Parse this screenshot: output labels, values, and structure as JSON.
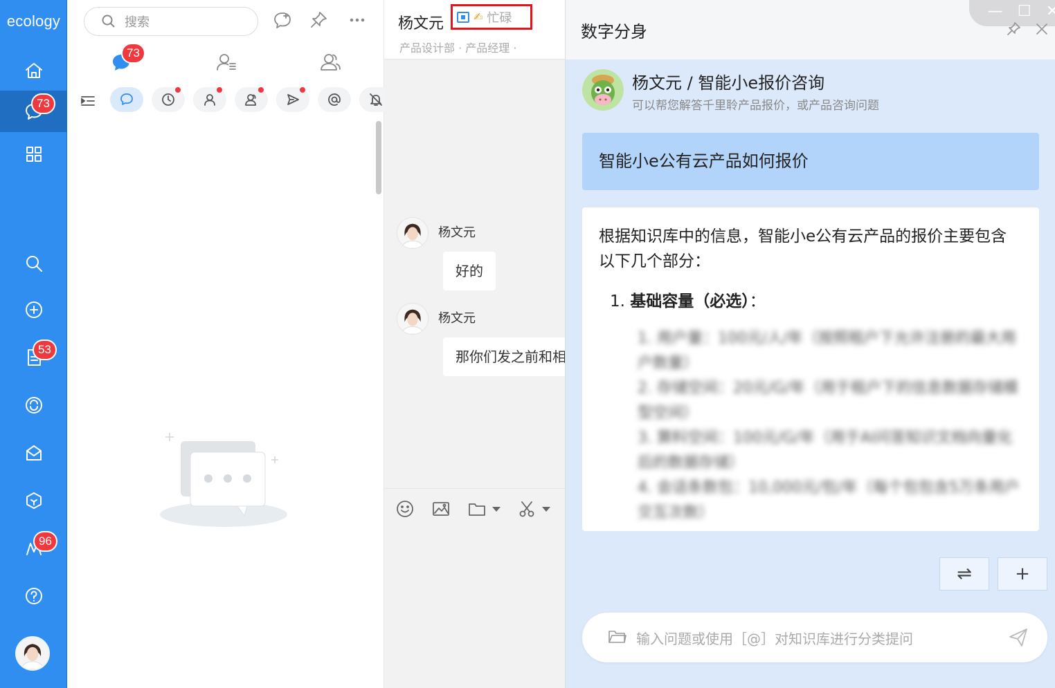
{
  "rail": {
    "logo": "ecology",
    "badges": {
      "messages": "73",
      "docs": "53",
      "m": "96"
    }
  },
  "list_pane": {
    "search_placeholder": "搜索",
    "tab_badge": "73"
  },
  "chat": {
    "contact_name": "杨文元",
    "status": "忙碌",
    "status_emoji": "✍",
    "dept": "产品设计部 · 产品经理 ·",
    "messages": [
      {
        "sender": "杨文元",
        "text": "好的"
      },
      {
        "sender": "杨文元",
        "text": "那你们发之前和相"
      }
    ]
  },
  "ai": {
    "title": "数字分身",
    "bot_title": "杨文元 / 智能小e报价咨询",
    "bot_desc": "可以帮您解答千里聆产品报价，或产品咨询问题",
    "question": "智能小e公有云产品如何报价",
    "answer_intro": "根据知识库中的信息，智能小e公有云产品的报价主要包含以下几个部分：",
    "answer_h1_num": "1.",
    "answer_h1": "基础容量（必选）",
    "answer_h1_colon": "：",
    "answer_items": [
      "1. 用户量：100元/人/年（按照租户下允许注册的最大用户数量）",
      "2. 存储空间：20元/G/年（用于租户下的信息数据存储模型空间）",
      "3. 算料空间：100元/G/年（用于AI问答知识文档向量化后的数据存储）",
      "4. 会话条数包：10,000元/包/年（每个包包含5万条用户交互次数）"
    ],
    "btn_switch": "⇌",
    "btn_add": "+",
    "input_placeholder": "输入问题或使用［@］对知识库进行分类提问"
  },
  "window": {
    "minimize": "—",
    "maximize": "☐",
    "close": "✕"
  },
  "colors": {
    "rail": "#2f8ef0",
    "badge": "#f0393e",
    "status_border": "#e0161e",
    "ai_bg": "#dce9fb",
    "question_bubble": "#b3d4fa"
  }
}
